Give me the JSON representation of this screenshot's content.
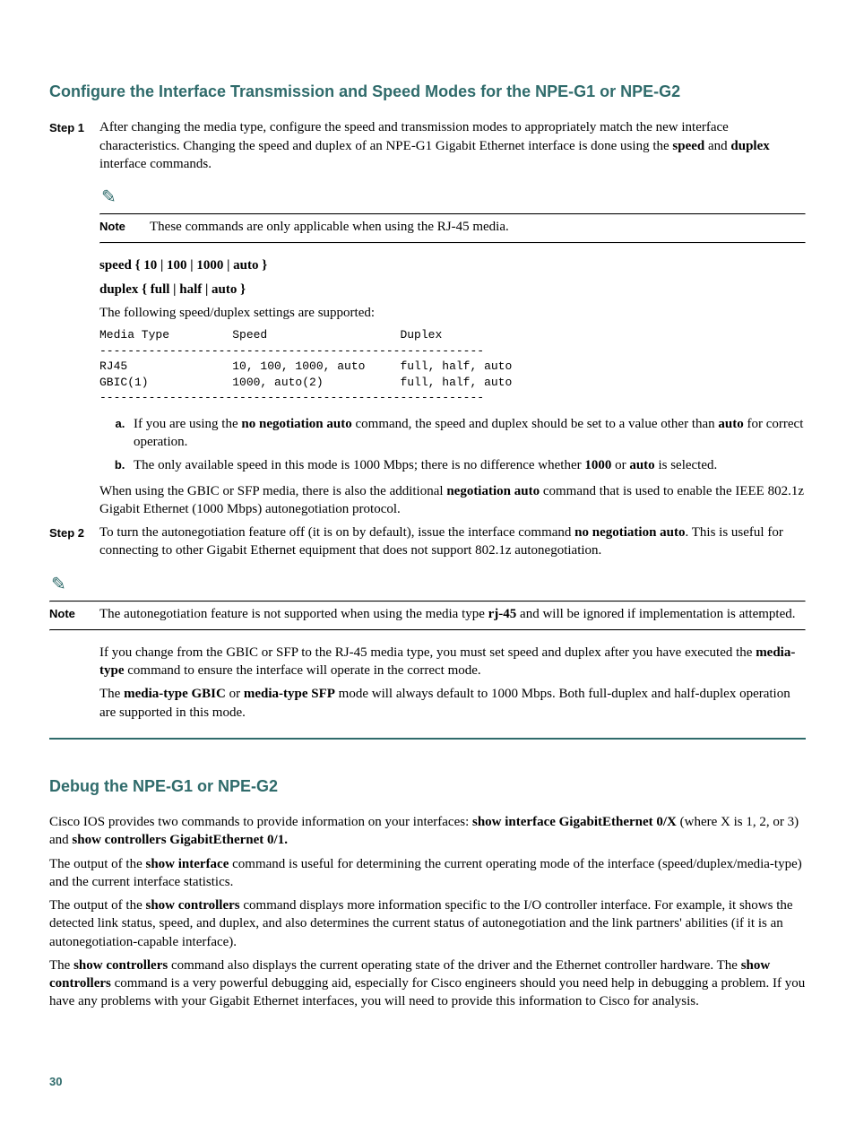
{
  "section1": {
    "heading": "Configure the Interface Transmission and Speed Modes for the NPE-G1 or NPE-G2",
    "step1_label": "Step 1",
    "step1_p1_a": "After changing the media type, configure the speed and transmission modes to appropriately match the new interface characteristics. Changing the speed and duplex of an NPE-G1 Gigabit Ethernet interface is done using the ",
    "step1_p1_b1": "speed",
    "step1_p1_c": " and ",
    "step1_p1_b2": "duplex",
    "step1_p1_d": " interface commands.",
    "note1_label": "Note",
    "note1_text": "These commands are only applicable when using the RJ-45 media.",
    "cmd_speed": "speed { 10 | 100 | 1000 | auto }",
    "cmd_duplex": "duplex { full | half | auto }",
    "supported_intro": "The following speed/duplex settings are supported:",
    "table": "Media Type         Speed                   Duplex\n-------------------------------------------------------\nRJ45               10, 100, 1000, auto     full, half, auto\nGBIC(1)            1000, auto(2)           full, half, auto\n-------------------------------------------------------",
    "li_a_a": "If you are using the ",
    "li_a_b": "no negotiation auto",
    "li_a_c": " command, the speed and duplex should be set to a value other than ",
    "li_a_d": "auto",
    "li_a_e": " for correct operation.",
    "li_b_a": "The only available speed in this mode is 1000 Mbps; there is no difference whether ",
    "li_b_b": "1000",
    "li_b_c": " or ",
    "li_b_d": "auto",
    "li_b_e": " is selected.",
    "gbic_p_a": "When using the GBIC or SFP media, there is also the additional ",
    "gbic_p_b": "negotiation auto",
    "gbic_p_c": " command that is used to enable the IEEE 802.1z Gigabit Ethernet (1000 Mbps) autonegotiation protocol.",
    "step2_label": "Step 2",
    "step2_a": "To turn the autonegotiation feature off (it is on by default), issue the interface command ",
    "step2_b": "no negotiation auto",
    "step2_c": ". This is useful for connecting to other Gigabit Ethernet equipment that does not support 802.1z autonegotiation.",
    "note2_label": "Note",
    "note2_a": "The autonegotiation feature is not supported when using the media type ",
    "note2_b": "rj-45",
    "note2_c": " and will be ignored if implementation is attempted.",
    "change_p_a": "If you change from the GBIC or SFP to the RJ-45 media type, you must set speed and duplex after you have executed the ",
    "change_p_b": "media-type",
    "change_p_c": " command to ensure the interface will operate in the correct mode.",
    "default_p_a": "The ",
    "default_p_b": "media-type GBIC",
    "default_p_c": " or ",
    "default_p_d": "media-type SFP",
    "default_p_e": " mode will always default to 1000 Mbps. Both full-duplex and half-duplex operation are supported in this mode."
  },
  "section2": {
    "heading": "Debug the NPE-G1 or NPE-G2",
    "p1_a": "Cisco IOS provides two commands to provide information on your interfaces: ",
    "p1_b": "show interface GigabitEthernet 0/X",
    "p1_c": " (where X is 1, 2, or 3) and ",
    "p1_d": "show controllers GigabitEthernet 0/1.",
    "p2_a": "The output of the ",
    "p2_b": "show interface",
    "p2_c": " command is useful for determining the current operating mode of the interface (speed/duplex/media-type) and the current interface statistics.",
    "p3_a": "The output of the ",
    "p3_b": "show controllers",
    "p3_c": " command displays more information specific to the I/O controller interface. For example, it shows the detected link status, speed, and duplex, and also determines the current status of autonegotiation and the link partners' abilities (if it is an autonegotiation-capable interface).",
    "p4_a": "The ",
    "p4_b": "show controllers",
    "p4_c": " command also displays the current operating state of the driver and the Ethernet controller hardware. The ",
    "p4_d": "show controllers",
    "p4_e": " command is a very powerful debugging aid, especially for Cisco engineers should you need help in debugging a problem. If you have any problems with your Gigabit Ethernet interfaces, you will need to provide this information to Cisco for analysis."
  },
  "page_number": "30",
  "chart_data": {
    "type": "table",
    "columns": [
      "Media Type",
      "Speed",
      "Duplex"
    ],
    "rows": [
      [
        "RJ45",
        "10, 100, 1000, auto",
        "full, half, auto"
      ],
      [
        "GBIC(1)",
        "1000, auto(2)",
        "full, half, auto"
      ]
    ]
  }
}
